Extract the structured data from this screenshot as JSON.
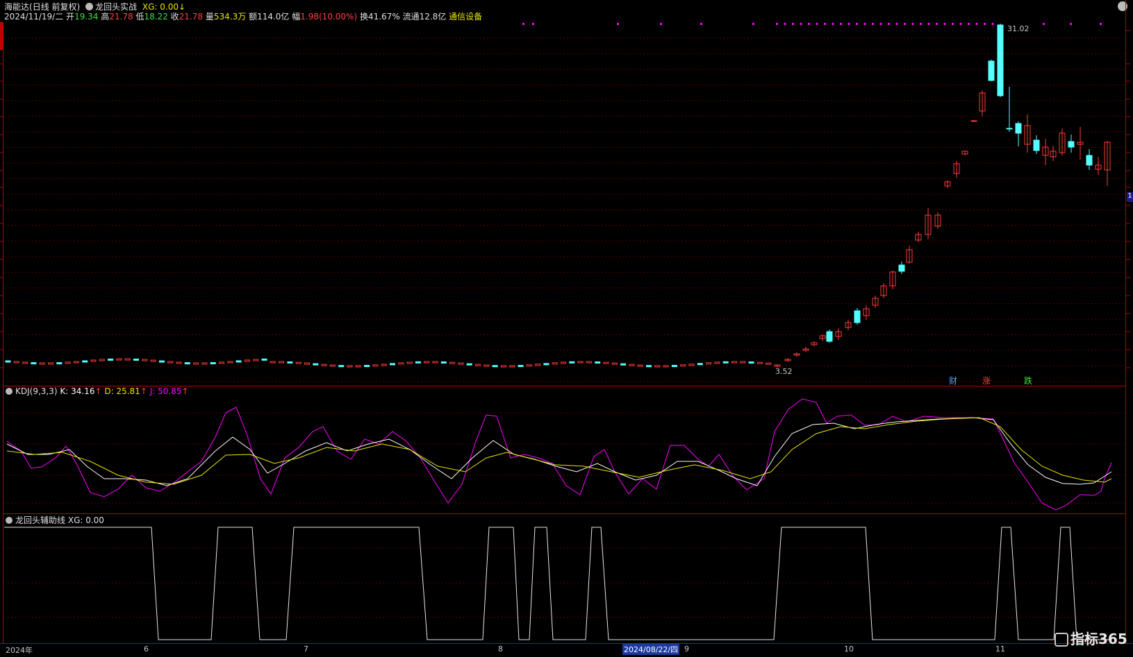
{
  "header": {
    "stock_name": "海能达",
    "period": "(日线 前复权)",
    "indicator_name": "龙回头实战",
    "xg_label": "XG: 0.00",
    "date": "2024/11/19/二",
    "open_label": "开",
    "open": "19.34",
    "high_label": "高",
    "high": "21.78",
    "low_label": "低",
    "low": "18.22",
    "close_label": "收",
    "close": "21.78",
    "volume_label": "量",
    "volume": "534.3万",
    "amount_label": "额",
    "amount": "114.0亿",
    "change_label": "幅",
    "change": "1.98(10.00%)",
    "turnover_label": "换",
    "turnover": "41.67%",
    "float_label": "流通",
    "float": "12.8亿",
    "sector": "通信设备"
  },
  "main_chart": {
    "high_marker": "31.02",
    "low_marker": "3.52",
    "badges": [
      {
        "text": "财",
        "color": "#5fa0ff"
      },
      {
        "text": "涨",
        "color": "#ff4040"
      },
      {
        "text": "跌",
        "color": "#40e040"
      }
    ],
    "right_tag": "1"
  },
  "kdj": {
    "name": "KDJ(9,3,3)",
    "k_label": "K: 34.16",
    "d_label": "D: 25.81",
    "j_label": "J: 50.85",
    "colors": {
      "k": "#ffffff",
      "d": "#e8e800",
      "j": "#ff00ff"
    }
  },
  "aux": {
    "name": "龙回头辅助线",
    "xg_label": "XG: 0.00"
  },
  "time_axis": {
    "labels": [
      "2024年",
      "6",
      "7",
      "8",
      "2024/08/22/四",
      "9",
      "10",
      "11"
    ]
  },
  "watermark": "指标365",
  "colors": {
    "up": "#ff3c3c",
    "down": "#54ffff",
    "border": "#b00000",
    "grid": "#5a0000",
    "dots": "#ff00ff"
  }
}
